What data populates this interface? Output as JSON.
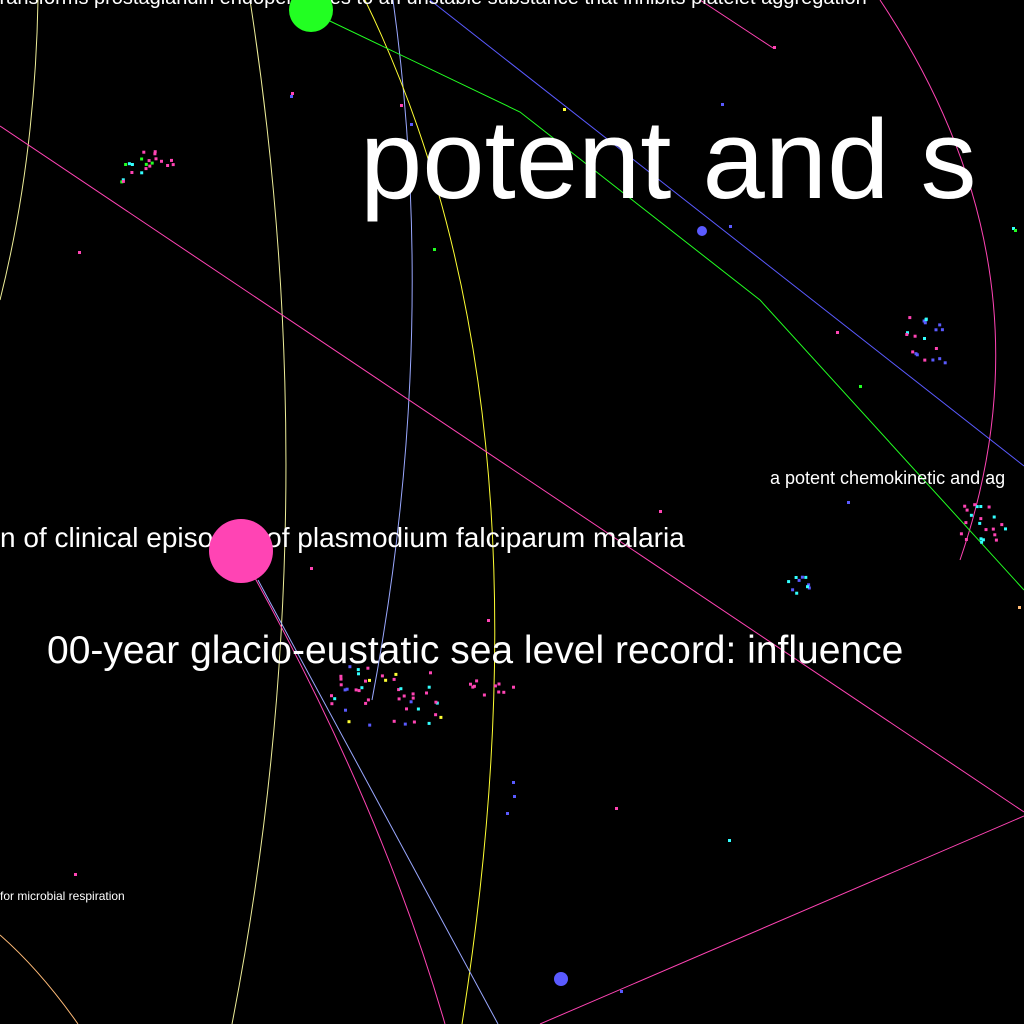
{
  "canvas": {
    "background": "#000000",
    "label_color": "#ffffff"
  },
  "palette": {
    "magenta": "#ff44b4",
    "green": "#22ff22",
    "blue": "#5a5aff",
    "yellow": "#ffff33",
    "cyan": "#33ffff",
    "pale_yellow": "#eeee99",
    "pale_blue": "#9aa8ff",
    "orange_tan": "#ffbb77"
  },
  "labels": {
    "platelet": "transforms prostaglandin endoperoxides to an unstable substance that inhibits platelet aggregation",
    "potent_large": "potent and s",
    "chemokinetic": "a potent chemokinetic and ag",
    "malaria": "n of clinical episodes of plasmodium falciparum malaria",
    "sea_level": "00-year glacio-eustatic sea level record: influence",
    "microbial": " for microbial respiration"
  }
}
